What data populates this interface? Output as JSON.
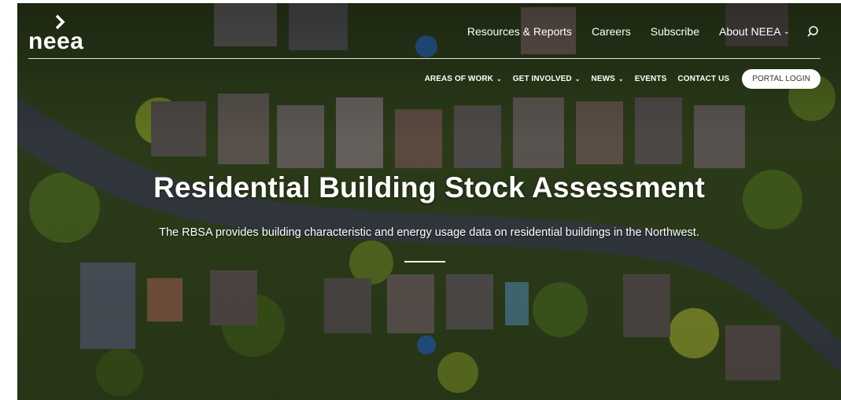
{
  "brand": {
    "name": "neea"
  },
  "top_nav": {
    "items": [
      {
        "label": "Resources & Reports",
        "dropdown": false
      },
      {
        "label": "Careers",
        "dropdown": false
      },
      {
        "label": "Subscribe",
        "dropdown": false
      },
      {
        "label": "About NEEA",
        "dropdown": true
      }
    ],
    "search_icon": "search-icon"
  },
  "sub_nav": {
    "items": [
      {
        "label": "AREAS OF WORK",
        "dropdown": true
      },
      {
        "label": "GET INVOLVED",
        "dropdown": true
      },
      {
        "label": "NEWS",
        "dropdown": true
      },
      {
        "label": "EVENTS",
        "dropdown": false
      },
      {
        "label": "CONTACT US",
        "dropdown": false
      }
    ],
    "portal_login": "PORTAL LOGIN"
  },
  "hero": {
    "title": "Residential Building Stock Assessment",
    "subtitle": "The RBSA provides building characteristic and energy usage data on residential buildings in the Northwest."
  },
  "colors": {
    "text": "#ffffff",
    "button_bg": "#ffffff",
    "button_text": "#333333",
    "foliage": "#3d5a22",
    "road": "#3a4148"
  }
}
